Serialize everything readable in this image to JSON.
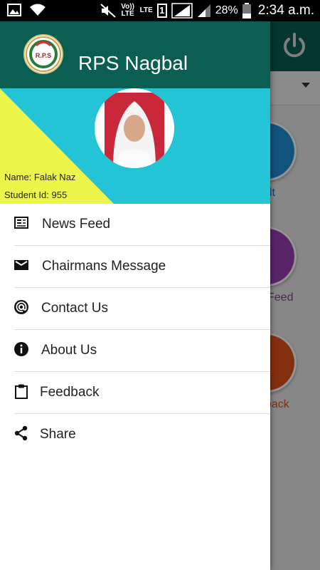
{
  "status_bar": {
    "volte_label": "Vo)) LTE",
    "lte_label": "LTE",
    "sim_label": "1",
    "battery": "28%",
    "time": "2:34 a.m."
  },
  "app": {
    "tiles": [
      {
        "label": "ult",
        "color": "#1e90d8"
      },
      {
        "label": "Feed",
        "color": "#9c3fb5"
      },
      {
        "label": "back",
        "color": "#e4531a"
      }
    ]
  },
  "drawer": {
    "title": "RPS Nagbal",
    "logo_text": "R.P.S",
    "student": {
      "name_line": "Name: Falak Naz",
      "id_line": "Student Id: 955"
    },
    "menu": [
      {
        "label": "News Feed",
        "icon": "newspaper-icon"
      },
      {
        "label": "Chairmans Message",
        "icon": "envelope-icon"
      },
      {
        "label": "Contact Us",
        "icon": "at-sign-icon"
      },
      {
        "label": "About Us",
        "icon": "info-icon"
      },
      {
        "label": "Feedback",
        "icon": "clipboard-icon"
      },
      {
        "label": "Share",
        "icon": "share-icon"
      }
    ]
  },
  "colors": {
    "primary": "#0a5e52",
    "profile_bg": "#22c4d5",
    "profile_accent": "#ecf549"
  }
}
